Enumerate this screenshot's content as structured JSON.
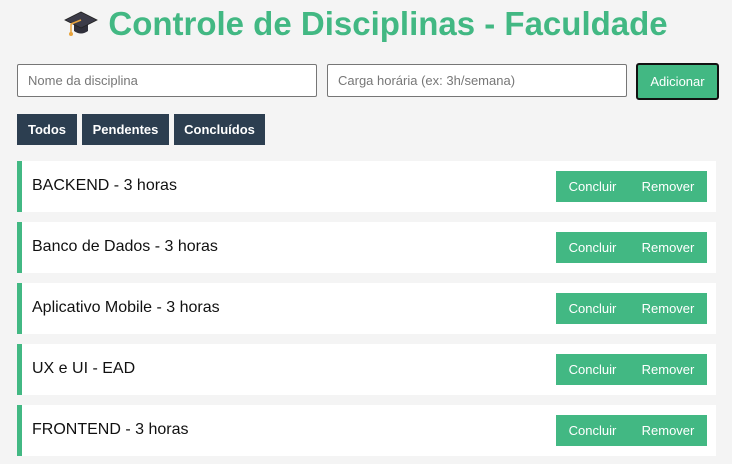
{
  "header": {
    "title": "Controle de Disciplinas - Faculdade",
    "icon": "graduation-cap-icon"
  },
  "form": {
    "nome_placeholder": "Nome da disciplina",
    "nome_value": "",
    "carga_placeholder": "Carga horária (ex: 3h/semana)",
    "carga_value": "",
    "add_label": "Adicionar"
  },
  "filters": [
    {
      "label": "Todos"
    },
    {
      "label": "Pendentes"
    },
    {
      "label": "Concluídos"
    }
  ],
  "items": [
    {
      "text": "BACKEND - 3 horas",
      "conclude_label": "Concluir",
      "remove_label": "Remover"
    },
    {
      "text": "Banco de Dados - 3 horas",
      "conclude_label": "Concluir",
      "remove_label": "Remover"
    },
    {
      "text": "Aplicativo Mobile - 3 horas",
      "conclude_label": "Concluir",
      "remove_label": "Remover"
    },
    {
      "text": "UX e UI - EAD",
      "conclude_label": "Concluir",
      "remove_label": "Remover"
    },
    {
      "text": "FRONTEND - 3 horas",
      "conclude_label": "Concluir",
      "remove_label": "Remover"
    }
  ],
  "colors": {
    "accent": "#42b883",
    "filter_bg": "#2c3e50",
    "page_bg": "#f4f4f4"
  }
}
